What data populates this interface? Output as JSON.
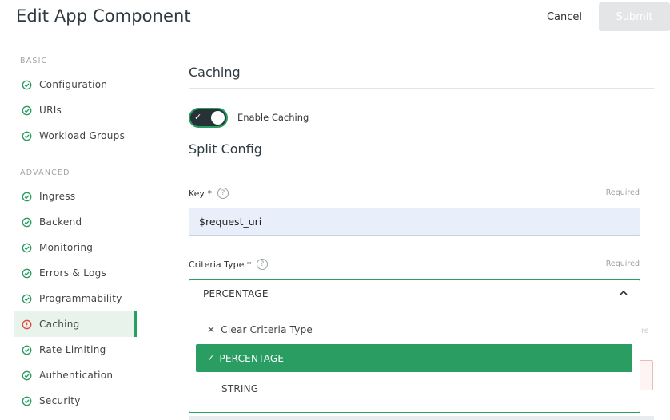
{
  "header": {
    "title": "Edit App Component",
    "cancel_label": "Cancel",
    "submit_label": "Submit"
  },
  "sidebar": {
    "sections": [
      {
        "label": "BASIC",
        "items": [
          {
            "label": "Configuration",
            "status": "complete"
          },
          {
            "label": "URIs",
            "status": "complete"
          },
          {
            "label": "Workload Groups",
            "status": "complete"
          }
        ]
      },
      {
        "label": "ADVANCED",
        "items": [
          {
            "label": "Ingress",
            "status": "complete"
          },
          {
            "label": "Backend",
            "status": "complete"
          },
          {
            "label": "Monitoring",
            "status": "complete"
          },
          {
            "label": "Errors & Logs",
            "status": "complete"
          },
          {
            "label": "Programmability",
            "status": "complete"
          },
          {
            "label": "Caching",
            "status": "error",
            "active": true
          },
          {
            "label": "Rate Limiting",
            "status": "complete"
          },
          {
            "label": "Authentication",
            "status": "complete"
          },
          {
            "label": "Security",
            "status": "complete"
          }
        ]
      }
    ]
  },
  "main": {
    "caching_title": "Caching",
    "enable_caching_label": "Enable Caching",
    "enable_caching_on": true,
    "split_config_title": "Split Config",
    "key": {
      "label": "Key",
      "required_star": "*",
      "help_glyph": "?",
      "required_text": "Required",
      "value": "$request_uri"
    },
    "criteria_type": {
      "label": "Criteria Type",
      "required_star": "*",
      "help_glyph": "?",
      "required_text": "Required",
      "value": "PERCENTAGE",
      "options": {
        "clear": "Clear Criteria Type",
        "percentage": "PERCENTAGE",
        "string": "STRING"
      }
    },
    "peek_text": "re"
  },
  "colors": {
    "accent": "#2a9d63",
    "error": "#e0483e",
    "toggle_bg": "#263238",
    "input_bg": "#e8effa"
  },
  "icons": {
    "complete": "check-circle-icon",
    "error": "alert-circle-icon",
    "help": "help-circle-icon",
    "chevron": "chevron-up-icon",
    "clear": "close-icon",
    "selected": "check-icon"
  }
}
